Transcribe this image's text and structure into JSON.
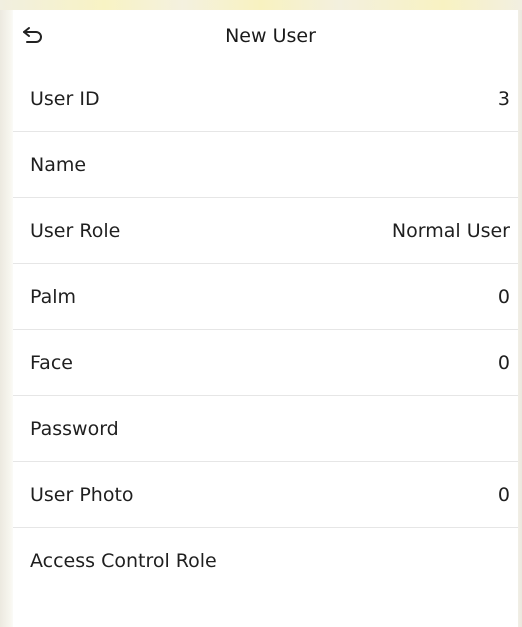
{
  "header": {
    "title": "New User",
    "back_icon": "back-arrow-icon"
  },
  "fields": [
    {
      "label": "User ID",
      "value": "3"
    },
    {
      "label": "Name",
      "value": ""
    },
    {
      "label": "User Role",
      "value": "Normal User"
    },
    {
      "label": "Palm",
      "value": "0"
    },
    {
      "label": "Face",
      "value": "0"
    },
    {
      "label": "Password",
      "value": ""
    },
    {
      "label": "User Photo",
      "value": "0"
    },
    {
      "label": "Access Control Role",
      "value": ""
    }
  ],
  "colors": {
    "text": "#1f1f1f",
    "divider": "#e6e6e6",
    "background": "#ffffff"
  }
}
